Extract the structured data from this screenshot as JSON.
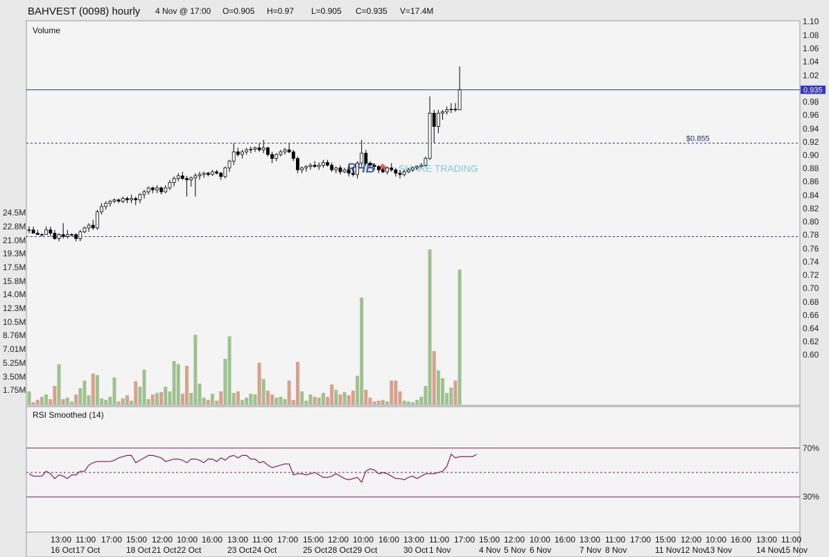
{
  "header": {
    "title": "BAHVEST (0098) hourly",
    "time": "4 Nov @ 17:00",
    "open": "O=0.905",
    "high": "H=0.97",
    "low": "L=0.905",
    "close": "C=0.935",
    "volume": "V=17.4M"
  },
  "panels": {
    "volume_label": "Volume",
    "rsi_label": "RSI Smoothed (14)"
  },
  "watermark": {
    "brand": "RHB",
    "text": "SHARE TRADING"
  },
  "price_axis": {
    "ticks": [
      "1.10",
      "1.08",
      "1.06",
      "1.04",
      "1.02",
      "1.00",
      "0.98",
      "0.96",
      "0.94",
      "0.92",
      "0.90",
      "0.88",
      "0.86",
      "0.84",
      "0.82",
      "0.80",
      "0.78",
      "0.76",
      "0.74",
      "0.72",
      "0.70",
      "0.68",
      "0.66",
      "0.64",
      "0.62",
      "0.60"
    ],
    "last_price_label": "0.935"
  },
  "volume_axis": {
    "ticks": [
      "24.5M",
      "22.8M",
      "21.0M",
      "19.3M",
      "17.5M",
      "15.8M",
      "14.0M",
      "12.3M",
      "10.5M",
      "8.76M",
      "7.01M",
      "5.25M",
      "3.50M",
      "1.75M"
    ]
  },
  "rsi_axis": {
    "upper": "70%",
    "lower": "30%"
  },
  "annotations": {
    "resistance_label": "$0.855"
  },
  "time_axis": {
    "times": [
      "13:00",
      "11:00",
      "17:00",
      "15:00",
      "12:00",
      "10:00",
      "16:00",
      "13:00",
      "11:00",
      "17:00",
      "15:00",
      "12:00",
      "10:00",
      "16:00",
      "13:00",
      "11:00",
      "17:00",
      "15:00",
      "12:00",
      "10:00",
      "16:00",
      "13:00",
      "11:00",
      "17:00",
      "15:00",
      "12:00",
      "10:00",
      "16:00",
      "13:00",
      "11:00"
    ],
    "dates": [
      "16 Oct",
      "17 Oct",
      "18 Oct",
      "21 Oct",
      "22 Oct",
      "23 Oct",
      "24 Oct",
      "25 Oct",
      "28 Oct",
      "29 Oct",
      "30 Oct",
      "1 Nov",
      "4 Nov",
      "5 Nov",
      "6 Nov",
      "7 Nov",
      "8 Nov",
      "11 Nov",
      "12 Nov",
      "13 Nov",
      "14 Nov",
      "15 Nov"
    ]
  },
  "colors": {
    "up_volume": "#9dc28f",
    "down_volume": "#d9a08c",
    "rsi_line": "#8b1a5a",
    "rsi_band": "#7a1e5a",
    "price_line": "#3333cc",
    "dashed_level": "#2a2aa0",
    "panel_bg": "#f4f4f4",
    "watermark_brand": "#2b4f9e",
    "watermark_text": "#68c3dc"
  },
  "chart_data": {
    "type": "candlestick",
    "interval": "hourly",
    "last_price": 0.935,
    "levels": [
      0.855,
      0.715
    ],
    "price_range": [
      0.58,
      1.1
    ],
    "volume_range": [
      0,
      25000000
    ],
    "rsi_levels": [
      70,
      30
    ],
    "candles": [
      {
        "o": 0.725,
        "h": 0.73,
        "l": 0.72,
        "c": 0.725,
        "v": 1.7
      },
      {
        "o": 0.725,
        "h": 0.73,
        "l": 0.72,
        "c": 0.72,
        "v": 0.3
      },
      {
        "o": 0.72,
        "h": 0.725,
        "l": 0.718,
        "c": 0.718,
        "v": 0.6
      },
      {
        "o": 0.718,
        "h": 0.72,
        "l": 0.715,
        "c": 0.718,
        "v": 1.0
      },
      {
        "o": 0.718,
        "h": 0.73,
        "l": 0.718,
        "c": 0.725,
        "v": 1.3
      },
      {
        "o": 0.725,
        "h": 0.73,
        "l": 0.715,
        "c": 0.72,
        "v": 0.7
      },
      {
        "o": 0.72,
        "h": 0.725,
        "l": 0.71,
        "c": 0.712,
        "v": 2.4
      },
      {
        "o": 0.712,
        "h": 0.72,
        "l": 0.708,
        "c": 0.718,
        "v": 5.2
      },
      {
        "o": 0.718,
        "h": 0.735,
        "l": 0.712,
        "c": 0.715,
        "v": 0.7
      },
      {
        "o": 0.715,
        "h": 0.725,
        "l": 0.712,
        "c": 0.718,
        "v": 0.9
      },
      {
        "o": 0.718,
        "h": 0.72,
        "l": 0.715,
        "c": 0.718,
        "v": 0.4
      },
      {
        "o": 0.718,
        "h": 0.72,
        "l": 0.708,
        "c": 0.712,
        "v": 1.3
      },
      {
        "o": 0.712,
        "h": 0.725,
        "l": 0.708,
        "c": 0.722,
        "v": 2.1
      },
      {
        "o": 0.722,
        "h": 0.73,
        "l": 0.72,
        "c": 0.728,
        "v": 3.1
      },
      {
        "o": 0.728,
        "h": 0.735,
        "l": 0.722,
        "c": 0.732,
        "v": 1.2
      },
      {
        "o": 0.732,
        "h": 0.74,
        "l": 0.725,
        "c": 0.728,
        "v": 4.0
      },
      {
        "o": 0.728,
        "h": 0.755,
        "l": 0.725,
        "c": 0.752,
        "v": 3.8
      },
      {
        "o": 0.752,
        "h": 0.765,
        "l": 0.748,
        "c": 0.76,
        "v": 0.8
      },
      {
        "o": 0.76,
        "h": 0.768,
        "l": 0.755,
        "c": 0.765,
        "v": 0.6
      },
      {
        "o": 0.765,
        "h": 0.77,
        "l": 0.76,
        "c": 0.768,
        "v": 1.0
      },
      {
        "o": 0.768,
        "h": 0.772,
        "l": 0.765,
        "c": 0.77,
        "v": 3.5
      },
      {
        "o": 0.77,
        "h": 0.772,
        "l": 0.765,
        "c": 0.768,
        "v": 0.4
      },
      {
        "o": 0.768,
        "h": 0.775,
        "l": 0.765,
        "c": 0.772,
        "v": 0.8
      },
      {
        "o": 0.772,
        "h": 0.775,
        "l": 0.765,
        "c": 0.77,
        "v": 1.2
      },
      {
        "o": 0.77,
        "h": 0.778,
        "l": 0.765,
        "c": 0.772,
        "v": 0.5
      },
      {
        "o": 0.772,
        "h": 0.775,
        "l": 0.762,
        "c": 0.77,
        "v": 3.0
      },
      {
        "o": 0.77,
        "h": 0.78,
        "l": 0.765,
        "c": 0.778,
        "v": 2.3
      },
      {
        "o": 0.778,
        "h": 0.785,
        "l": 0.772,
        "c": 0.782,
        "v": 4.5
      },
      {
        "o": 0.782,
        "h": 0.79,
        "l": 0.778,
        "c": 0.788,
        "v": 0.7
      },
      {
        "o": 0.788,
        "h": 0.79,
        "l": 0.78,
        "c": 0.785,
        "v": 1.3
      },
      {
        "o": 0.785,
        "h": 0.792,
        "l": 0.78,
        "c": 0.788,
        "v": 1.5
      },
      {
        "o": 0.788,
        "h": 0.79,
        "l": 0.778,
        "c": 0.782,
        "v": 1.6
      },
      {
        "o": 0.782,
        "h": 0.792,
        "l": 0.78,
        "c": 0.788,
        "v": 2.3
      },
      {
        "o": 0.788,
        "h": 0.8,
        "l": 0.785,
        "c": 0.796,
        "v": 1.7
      },
      {
        "o": 0.796,
        "h": 0.805,
        "l": 0.79,
        "c": 0.802,
        "v": 5.6
      },
      {
        "o": 0.802,
        "h": 0.81,
        "l": 0.798,
        "c": 0.806,
        "v": 5.2
      },
      {
        "o": 0.806,
        "h": 0.812,
        "l": 0.8,
        "c": 0.802,
        "v": 1.4
      },
      {
        "o": 0.802,
        "h": 0.806,
        "l": 0.775,
        "c": 0.8,
        "v": 5.0
      },
      {
        "o": 0.8,
        "h": 0.805,
        "l": 0.79,
        "c": 0.803,
        "v": 1.5
      },
      {
        "o": 0.803,
        "h": 0.81,
        "l": 0.775,
        "c": 0.806,
        "v": 9.0
      },
      {
        "o": 0.806,
        "h": 0.812,
        "l": 0.8,
        "c": 0.808,
        "v": 2.7
      },
      {
        "o": 0.808,
        "h": 0.812,
        "l": 0.803,
        "c": 0.81,
        "v": 0.9
      },
      {
        "o": 0.81,
        "h": 0.812,
        "l": 0.805,
        "c": 0.808,
        "v": 0.6
      },
      {
        "o": 0.808,
        "h": 0.815,
        "l": 0.806,
        "c": 0.812,
        "v": 1.4
      },
      {
        "o": 0.812,
        "h": 0.815,
        "l": 0.808,
        "c": 0.81,
        "v": 0.5
      },
      {
        "o": 0.81,
        "h": 0.812,
        "l": 0.8,
        "c": 0.805,
        "v": 1.7
      },
      {
        "o": 0.805,
        "h": 0.82,
        "l": 0.802,
        "c": 0.818,
        "v": 5.9
      },
      {
        "o": 0.818,
        "h": 0.83,
        "l": 0.812,
        "c": 0.828,
        "v": 8.8
      },
      {
        "o": 0.828,
        "h": 0.855,
        "l": 0.822,
        "c": 0.842,
        "v": 1.5
      },
      {
        "o": 0.842,
        "h": 0.848,
        "l": 0.835,
        "c": 0.838,
        "v": 1.7
      },
      {
        "o": 0.838,
        "h": 0.845,
        "l": 0.832,
        "c": 0.842,
        "v": 0.6
      },
      {
        "o": 0.842,
        "h": 0.848,
        "l": 0.838,
        "c": 0.845,
        "v": 0.9
      },
      {
        "o": 0.845,
        "h": 0.85,
        "l": 0.84,
        "c": 0.846,
        "v": 1.4
      },
      {
        "o": 0.846,
        "h": 0.85,
        "l": 0.842,
        "c": 0.848,
        "v": 1.3
      },
      {
        "o": 0.848,
        "h": 0.855,
        "l": 0.842,
        "c": 0.845,
        "v": 5.4
      },
      {
        "o": 0.845,
        "h": 0.86,
        "l": 0.84,
        "c": 0.848,
        "v": 3.3
      },
      {
        "o": 0.848,
        "h": 0.85,
        "l": 0.835,
        "c": 0.838,
        "v": 1.8
      },
      {
        "o": 0.838,
        "h": 0.842,
        "l": 0.825,
        "c": 0.832,
        "v": 1.3
      },
      {
        "o": 0.832,
        "h": 0.84,
        "l": 0.828,
        "c": 0.838,
        "v": 0.9
      },
      {
        "o": 0.838,
        "h": 0.845,
        "l": 0.835,
        "c": 0.842,
        "v": 1.0
      },
      {
        "o": 0.842,
        "h": 0.848,
        "l": 0.838,
        "c": 0.845,
        "v": 0.7
      },
      {
        "o": 0.845,
        "h": 0.855,
        "l": 0.84,
        "c": 0.842,
        "v": 3.1
      },
      {
        "o": 0.842,
        "h": 0.845,
        "l": 0.828,
        "c": 0.832,
        "v": 0.6
      },
      {
        "o": 0.832,
        "h": 0.835,
        "l": 0.81,
        "c": 0.815,
        "v": 5.5
      },
      {
        "o": 0.815,
        "h": 0.82,
        "l": 0.81,
        "c": 0.818,
        "v": 1.7
      },
      {
        "o": 0.818,
        "h": 0.822,
        "l": 0.812,
        "c": 0.82,
        "v": 0.5
      },
      {
        "o": 0.82,
        "h": 0.825,
        "l": 0.815,
        "c": 0.822,
        "v": 1.3
      },
      {
        "o": 0.822,
        "h": 0.828,
        "l": 0.818,
        "c": 0.82,
        "v": 1.0
      },
      {
        "o": 0.82,
        "h": 0.826,
        "l": 0.815,
        "c": 0.822,
        "v": 0.9
      },
      {
        "o": 0.822,
        "h": 0.83,
        "l": 0.818,
        "c": 0.826,
        "v": 1.5
      },
      {
        "o": 0.826,
        "h": 0.83,
        "l": 0.82,
        "c": 0.822,
        "v": 1.0
      },
      {
        "o": 0.822,
        "h": 0.826,
        "l": 0.812,
        "c": 0.815,
        "v": 2.6
      },
      {
        "o": 0.815,
        "h": 0.82,
        "l": 0.81,
        "c": 0.818,
        "v": 1.9
      },
      {
        "o": 0.818,
        "h": 0.822,
        "l": 0.808,
        "c": 0.812,
        "v": 1.3
      },
      {
        "o": 0.812,
        "h": 0.818,
        "l": 0.81,
        "c": 0.815,
        "v": 1.6
      },
      {
        "o": 0.815,
        "h": 0.82,
        "l": 0.805,
        "c": 0.81,
        "v": 1.2
      },
      {
        "o": 0.81,
        "h": 0.82,
        "l": 0.805,
        "c": 0.808,
        "v": 1.8
      },
      {
        "o": 0.808,
        "h": 0.828,
        "l": 0.802,
        "c": 0.825,
        "v": 3.7
      },
      {
        "o": 0.825,
        "h": 0.86,
        "l": 0.82,
        "c": 0.84,
        "v": 13.8
      },
      {
        "o": 0.84,
        "h": 0.845,
        "l": 0.822,
        "c": 0.825,
        "v": 1.9
      },
      {
        "o": 0.825,
        "h": 0.828,
        "l": 0.818,
        "c": 0.822,
        "v": 0.9
      },
      {
        "o": 0.822,
        "h": 0.825,
        "l": 0.815,
        "c": 0.82,
        "v": 0.4
      },
      {
        "o": 0.82,
        "h": 0.822,
        "l": 0.81,
        "c": 0.815,
        "v": 0.5
      },
      {
        "o": 0.815,
        "h": 0.818,
        "l": 0.81,
        "c": 0.812,
        "v": 0.6
      },
      {
        "o": 0.812,
        "h": 0.82,
        "l": 0.808,
        "c": 0.818,
        "v": 0.4
      },
      {
        "o": 0.818,
        "h": 0.825,
        "l": 0.812,
        "c": 0.815,
        "v": 3.1
      },
      {
        "o": 0.815,
        "h": 0.818,
        "l": 0.805,
        "c": 0.81,
        "v": 3.1
      },
      {
        "o": 0.81,
        "h": 0.815,
        "l": 0.802,
        "c": 0.808,
        "v": 1.7
      },
      {
        "o": 0.808,
        "h": 0.815,
        "l": 0.805,
        "c": 0.812,
        "v": 0.5
      },
      {
        "o": 0.812,
        "h": 0.818,
        "l": 0.81,
        "c": 0.815,
        "v": 0.4
      },
      {
        "o": 0.815,
        "h": 0.82,
        "l": 0.812,
        "c": 0.818,
        "v": 0.3
      },
      {
        "o": 0.818,
        "h": 0.822,
        "l": 0.815,
        "c": 0.82,
        "v": 0.6
      },
      {
        "o": 0.82,
        "h": 0.825,
        "l": 0.818,
        "c": 0.822,
        "v": 1.0
      },
      {
        "o": 0.822,
        "h": 0.835,
        "l": 0.82,
        "c": 0.832,
        "v": 2.4
      },
      {
        "o": 0.832,
        "h": 0.925,
        "l": 0.83,
        "c": 0.9,
        "v": 20.0
      },
      {
        "o": 0.9,
        "h": 0.905,
        "l": 0.855,
        "c": 0.88,
        "v": 6.9
      },
      {
        "o": 0.88,
        "h": 0.905,
        "l": 0.87,
        "c": 0.9,
        "v": 4.4
      },
      {
        "o": 0.9,
        "h": 0.905,
        "l": 0.89,
        "c": 0.902,
        "v": 3.4
      },
      {
        "o": 0.902,
        "h": 0.91,
        "l": 0.898,
        "c": 0.905,
        "v": 1.5
      },
      {
        "o": 0.905,
        "h": 0.915,
        "l": 0.9,
        "c": 0.906,
        "v": 2.2
      },
      {
        "o": 0.906,
        "h": 0.915,
        "l": 0.902,
        "c": 0.905,
        "v": 3.1
      },
      {
        "o": 0.905,
        "h": 0.97,
        "l": 0.905,
        "c": 0.935,
        "v": 17.4
      }
    ],
    "rsi": [
      49,
      47,
      47,
      47,
      51,
      49,
      45,
      48,
      47,
      45,
      48,
      48,
      51,
      51,
      56,
      58,
      59,
      59,
      59,
      59,
      60,
      62,
      63,
      64,
      64,
      58,
      60,
      62,
      64,
      64,
      63,
      62,
      59,
      60,
      61,
      61,
      60,
      58,
      61,
      61,
      60,
      58,
      61,
      61,
      59,
      62,
      60,
      63,
      64,
      62,
      64,
      64,
      61,
      61,
      58,
      59,
      56,
      54,
      55,
      56,
      57,
      57,
      48,
      49,
      49,
      48,
      49,
      50,
      48,
      46,
      46,
      47,
      49,
      47,
      45,
      44,
      45,
      46,
      42,
      51,
      53,
      52,
      49,
      50,
      49,
      47,
      45,
      45,
      44,
      46,
      47,
      45,
      47,
      49,
      49,
      49,
      50,
      51,
      55,
      65,
      62,
      63,
      63,
      63,
      63,
      65
    ]
  }
}
